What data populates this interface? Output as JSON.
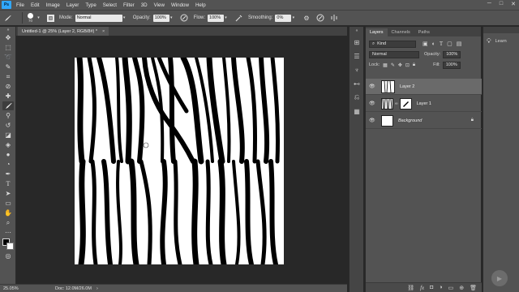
{
  "menubar": {
    "items": [
      "File",
      "Edit",
      "Image",
      "Layer",
      "Type",
      "Select",
      "Filter",
      "3D",
      "View",
      "Window",
      "Help"
    ],
    "window_controls": [
      "─",
      "□",
      "✕"
    ]
  },
  "options": {
    "brush_size": "70",
    "mode_label": "Mode:",
    "mode_value": "Normal",
    "opacity_label": "Opacity:",
    "opacity_value": "100%",
    "flow_label": "Flow:",
    "flow_value": "100%",
    "smoothing_label": "Smoothing:",
    "smoothing_value": "0%"
  },
  "document": {
    "tab_title": "Untitled-1 @ 25% (Layer 2, RGB/8#) *",
    "close": "×"
  },
  "status": {
    "zoom": "25.05%",
    "doc_info": "Doc: 12.0M/26.0M",
    "arrow": "›"
  },
  "layers_panel": {
    "tabs": [
      "Layers",
      "Channels",
      "Paths"
    ],
    "filter_kind": "Kind",
    "blend_mode": "Normal",
    "opacity_label": "Opacity:",
    "opacity_value": "100%",
    "lock_label": "Lock:",
    "fill_label": "Fill:",
    "fill_value": "100%",
    "layers": [
      {
        "name": "Layer 2",
        "selected": true
      },
      {
        "name": "Layer 1",
        "selected": false
      },
      {
        "name": "Background",
        "selected": false,
        "locked": true
      }
    ]
  },
  "learn_panel": {
    "label": "Learn"
  },
  "colors": {
    "accent": "#31a8ff",
    "panel": "#535353",
    "workspace": "#282828"
  }
}
